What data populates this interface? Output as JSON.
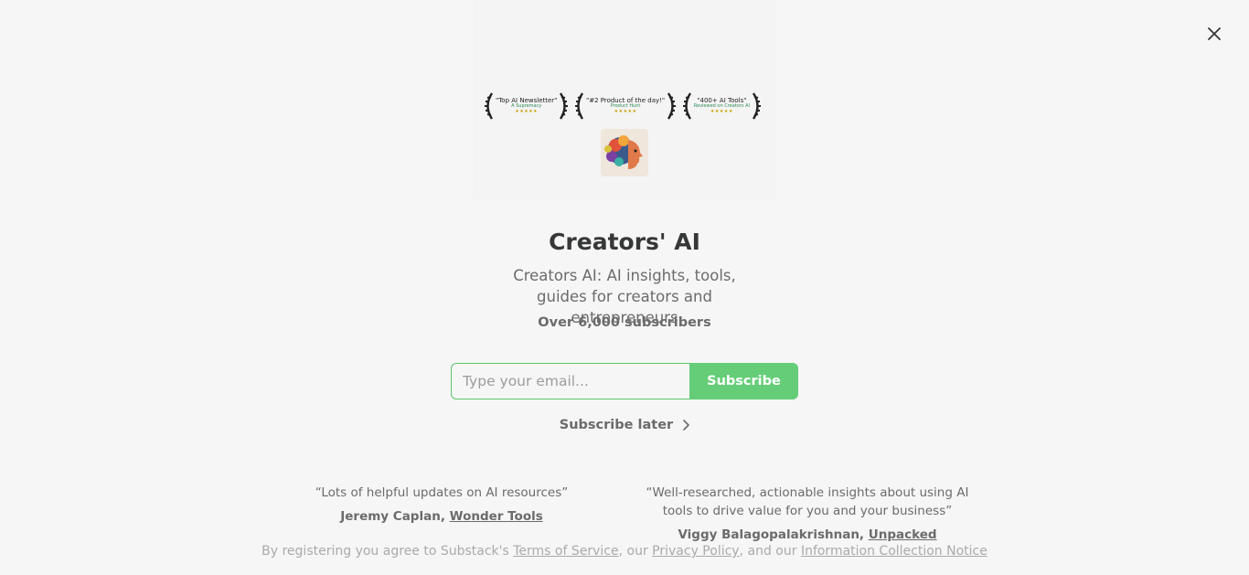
{
  "close_icon": "close-icon",
  "awards": [
    {
      "quote": "\"Top AI Newsletter\"",
      "source": "A Supremacy",
      "stars": "★★★★★"
    },
    {
      "quote": "\"#2 Product of the day!\"",
      "source": "Product Hunt",
      "stars": "★★★★★"
    },
    {
      "quote": "\"400+ AI Tools\"",
      "source": "Reviewed on Creators AI",
      "stars": "★★★★★"
    }
  ],
  "publication": {
    "title": "Creators' AI",
    "description": "Creators AI: AI insights, tools, guides for creators and entrepreneurs",
    "subscribers": "Over 6,000 subscribers"
  },
  "form": {
    "email_placeholder": "Type your email...",
    "email_value": "",
    "subscribe_label": "Subscribe",
    "subscribe_later_label": "Subscribe later"
  },
  "testimonials": [
    {
      "quote": "“Lots of helpful updates on AI resources”",
      "author": "Jeremy Caplan, ",
      "publication": "Wonder Tools"
    },
    {
      "quote": "“Well-researched, actionable insights about using AI tools to drive value for you and your business”",
      "author": "Viggy Balagopalakrishnan, ",
      "publication": "Unpacked"
    }
  ],
  "legal": {
    "prefix": "By registering you agree to Substack's ",
    "terms": "Terms of Service",
    "mid1": ", our ",
    "privacy": "Privacy Policy",
    "mid2": ", and our ",
    "notice": "Information Collection Notice"
  },
  "colors": {
    "accent": "#65cd77",
    "background": "#f6f6f6",
    "text": "#363737",
    "muted": "#6b6b6b"
  }
}
